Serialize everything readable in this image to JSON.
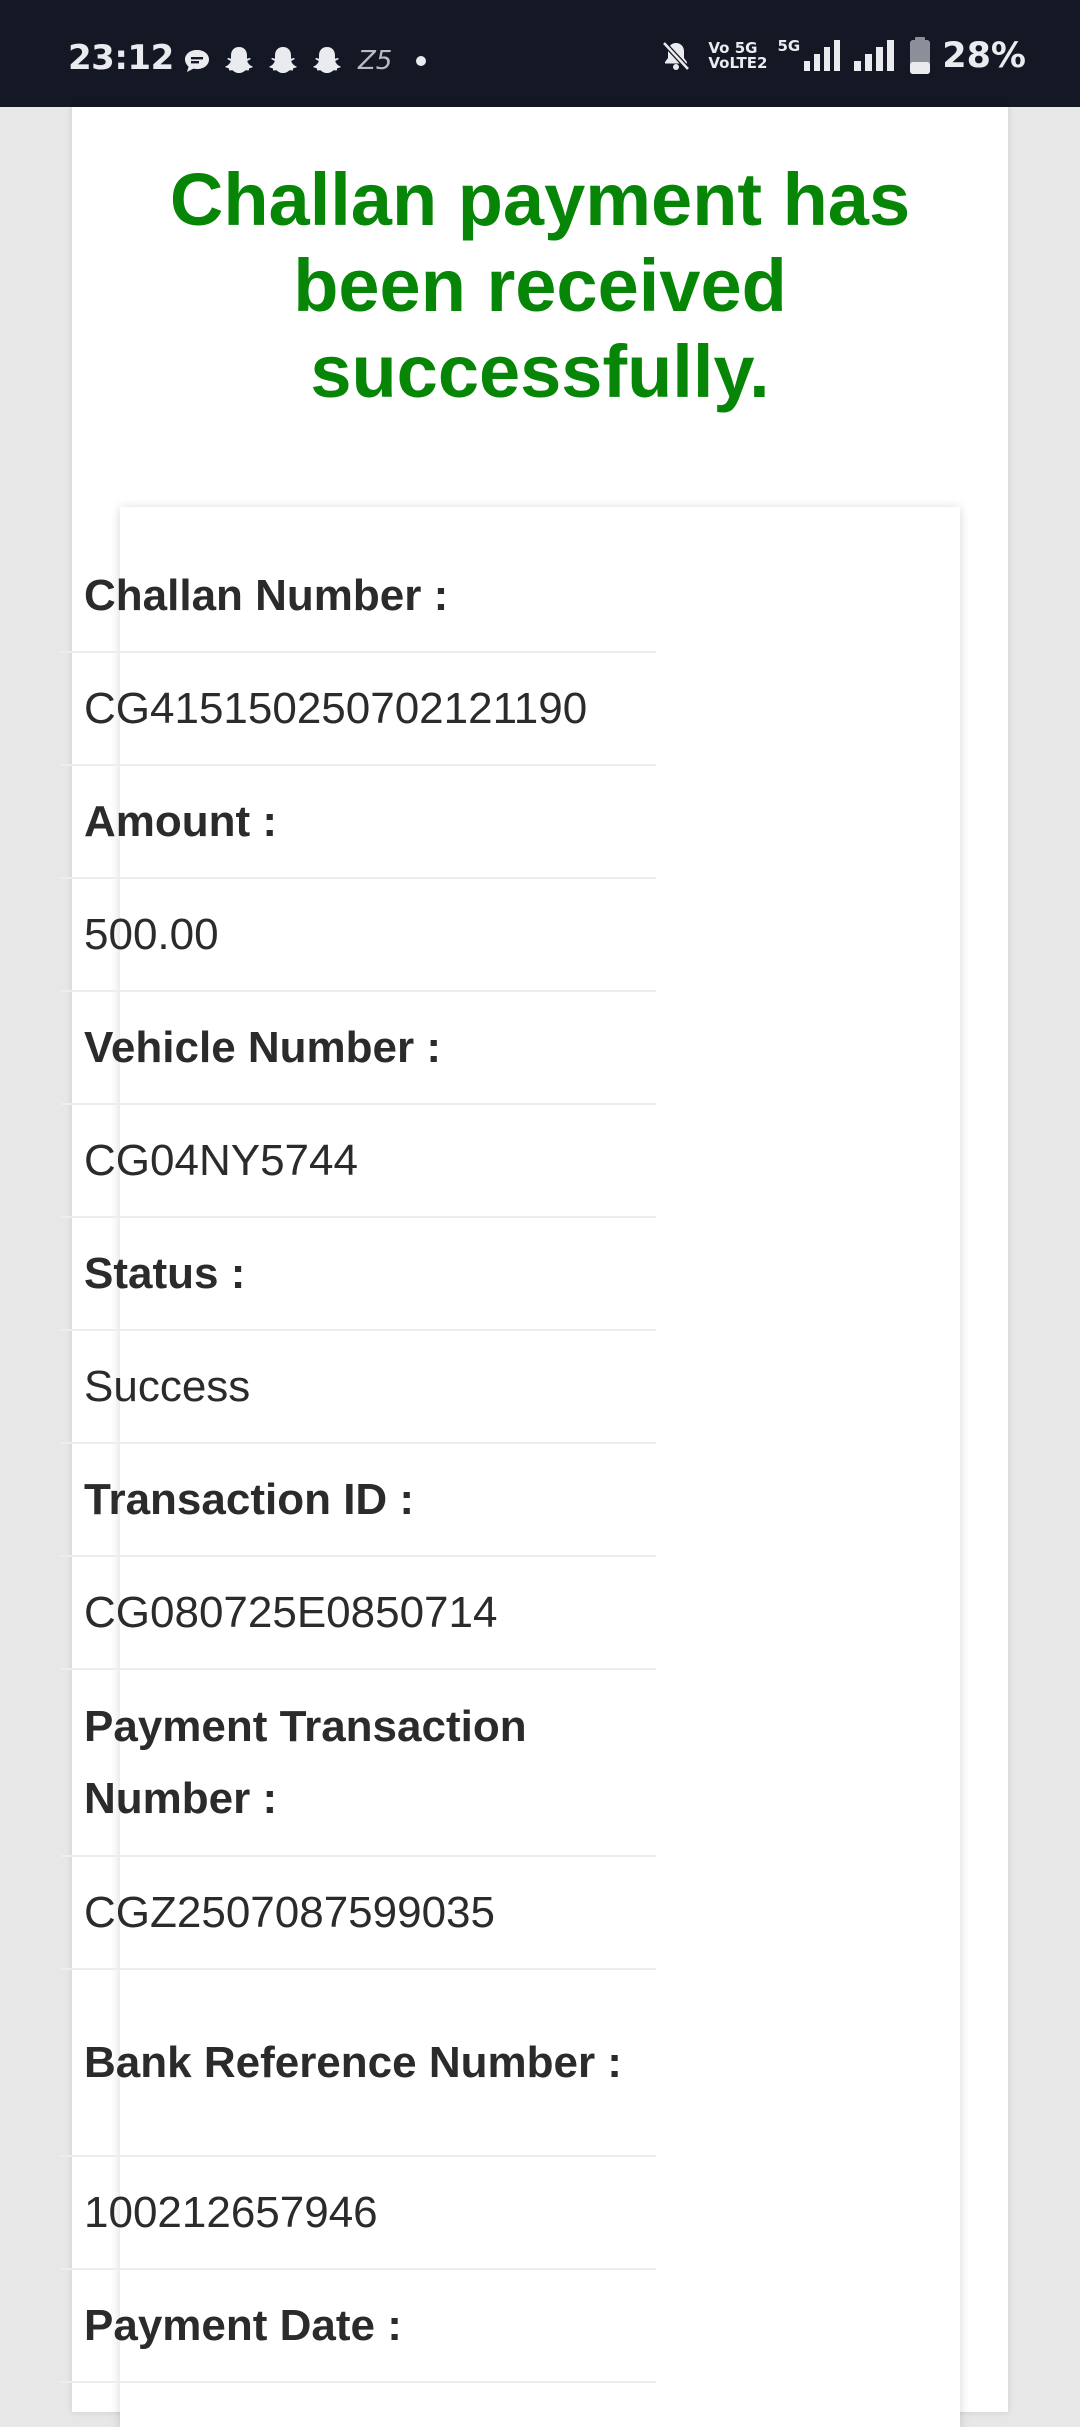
{
  "status_bar": {
    "time": "23:12",
    "volte_top": "Vo 5G",
    "volte_bottom": "VoLTE2",
    "network": "5G",
    "battery": "28%",
    "left_icons": [
      "chat-icon",
      "snapchat-icon",
      "snapchat-icon",
      "snapchat-icon",
      "z5-app-icon",
      "dot"
    ],
    "z5_label": "Z5",
    "colors": {
      "background": "#141824",
      "foreground": "#e9ebef"
    }
  },
  "headline": "Challan payment has been received successfully.",
  "details": [
    {
      "label": "Challan Number :",
      "value": "CG4151502507021211​90"
    },
    {
      "label": "Amount :",
      "value": "500.00"
    },
    {
      "label": "Vehicle Number :",
      "value": "CG04NY5744"
    },
    {
      "label": "Status :",
      "value": "Success"
    },
    {
      "label": "Transaction ID :",
      "value": "CG080725E0850714"
    },
    {
      "label": "Payment Transaction Number :",
      "value": "CGZ2507087599035"
    },
    {
      "label": "Bank Reference Number :",
      "value": "100212657946"
    },
    {
      "label": "Payment Date :"
    }
  ],
  "colors": {
    "headline": "#068506",
    "text": "#2b2b2b",
    "page_bg": "#e6e7e6",
    "divider": "#eceeee"
  }
}
